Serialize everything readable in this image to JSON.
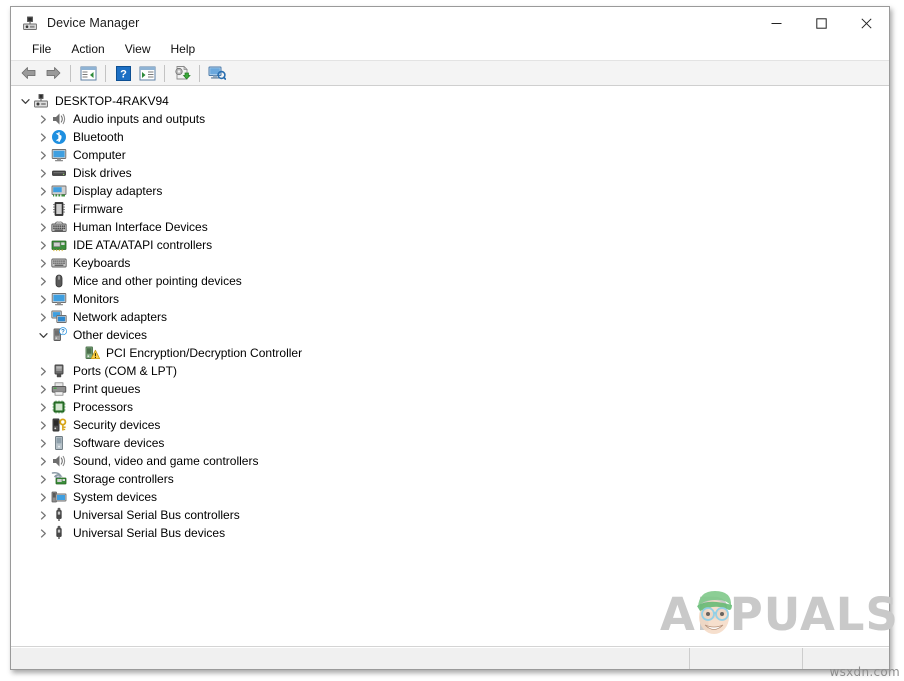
{
  "window": {
    "title": "Device Manager",
    "icon": "device-manager-icon",
    "caption": {
      "minimize": "—",
      "maximize": "☐",
      "close": "✕",
      "minimize_name": "minimize-button",
      "maximize_name": "maximize-button",
      "close_name": "close-button"
    }
  },
  "menubar": {
    "items": [
      {
        "label": "File",
        "name": "menu-file"
      },
      {
        "label": "Action",
        "name": "menu-action"
      },
      {
        "label": "View",
        "name": "menu-view"
      },
      {
        "label": "Help",
        "name": "menu-help"
      }
    ]
  },
  "toolbar": {
    "buttons": [
      {
        "name": "back-button",
        "icon": "back-arrow-icon",
        "tooltip": "Back"
      },
      {
        "name": "forward-button",
        "icon": "forward-arrow-icon",
        "tooltip": "Forward"
      },
      {
        "name": "separator-1",
        "icon": "separator"
      },
      {
        "name": "show-hide-console-tree-button",
        "icon": "console-tree-icon",
        "tooltip": "Show/Hide console tree"
      },
      {
        "name": "separator-2",
        "icon": "separator"
      },
      {
        "name": "help-button",
        "icon": "help-question-icon",
        "tooltip": "Help"
      },
      {
        "name": "properties-button",
        "icon": "properties-window-icon",
        "tooltip": "Properties"
      },
      {
        "name": "separator-3",
        "icon": "separator"
      },
      {
        "name": "update-driver-button",
        "icon": "update-driver-icon",
        "tooltip": "Update driver"
      },
      {
        "name": "separator-4",
        "icon": "separator"
      },
      {
        "name": "scan-hardware-changes-button",
        "icon": "scan-monitor-icon",
        "tooltip": "Scan for hardware changes"
      }
    ]
  },
  "tree": {
    "nodes": [
      {
        "label": "DESKTOP-4RAKV94",
        "level": 0,
        "expander": "expanded",
        "icon": "computer-root-icon",
        "name": "tree-node-desktop-4rakv94"
      },
      {
        "label": "Audio inputs and outputs",
        "level": 1,
        "expander": "collapsed",
        "icon": "speaker-icon",
        "name": "tree-node-audio-inputs-and-outputs"
      },
      {
        "label": "Bluetooth",
        "level": 1,
        "expander": "collapsed",
        "icon": "bluetooth-icon",
        "name": "tree-node-bluetooth"
      },
      {
        "label": "Computer",
        "level": 1,
        "expander": "collapsed",
        "icon": "monitor-icon",
        "name": "tree-node-computer"
      },
      {
        "label": "Disk drives",
        "level": 1,
        "expander": "collapsed",
        "icon": "disk-drive-icon",
        "name": "tree-node-disk-drives"
      },
      {
        "label": "Display adapters",
        "level": 1,
        "expander": "collapsed",
        "icon": "display-adapter-icon",
        "name": "tree-node-display-adapters"
      },
      {
        "label": "Firmware",
        "level": 1,
        "expander": "collapsed",
        "icon": "firmware-chip-icon",
        "name": "tree-node-firmware"
      },
      {
        "label": "Human Interface Devices",
        "level": 1,
        "expander": "collapsed",
        "icon": "hid-keyboard-icon",
        "name": "tree-node-human-interface-devices"
      },
      {
        "label": "IDE ATA/ATAPI controllers",
        "level": 1,
        "expander": "collapsed",
        "icon": "ide-controller-icon",
        "name": "tree-node-ide-ata-atapi-controllers"
      },
      {
        "label": "Keyboards",
        "level": 1,
        "expander": "collapsed",
        "icon": "keyboard-icon",
        "name": "tree-node-keyboards"
      },
      {
        "label": "Mice and other pointing devices",
        "level": 1,
        "expander": "collapsed",
        "icon": "mouse-icon",
        "name": "tree-node-mice-and-other-pointing-devices"
      },
      {
        "label": "Monitors",
        "level": 1,
        "expander": "collapsed",
        "icon": "monitor-icon",
        "name": "tree-node-monitors"
      },
      {
        "label": "Network adapters",
        "level": 1,
        "expander": "collapsed",
        "icon": "network-adapter-icon",
        "name": "tree-node-network-adapters"
      },
      {
        "label": "Other devices",
        "level": 1,
        "expander": "expanded",
        "icon": "unknown-device-icon",
        "name": "tree-node-other-devices"
      },
      {
        "label": "PCI Encryption/Decryption Controller",
        "level": 2,
        "expander": "none",
        "icon": "warning-device-icon",
        "name": "tree-node-pci-encryption-decryption-controller"
      },
      {
        "label": "Ports (COM & LPT)",
        "level": 1,
        "expander": "collapsed",
        "icon": "port-icon",
        "name": "tree-node-ports-com-and-lpt"
      },
      {
        "label": "Print queues",
        "level": 1,
        "expander": "collapsed",
        "icon": "printer-icon",
        "name": "tree-node-print-queues"
      },
      {
        "label": "Processors",
        "level": 1,
        "expander": "collapsed",
        "icon": "processor-chip-icon",
        "name": "tree-node-processors"
      },
      {
        "label": "Security devices",
        "level": 1,
        "expander": "collapsed",
        "icon": "security-key-icon",
        "name": "tree-node-security-devices"
      },
      {
        "label": "Software devices",
        "level": 1,
        "expander": "collapsed",
        "icon": "software-device-icon",
        "name": "tree-node-software-devices"
      },
      {
        "label": "Sound, video and game controllers",
        "level": 1,
        "expander": "collapsed",
        "icon": "speaker-icon",
        "name": "tree-node-sound-video-and-game-controllers"
      },
      {
        "label": "Storage controllers",
        "level": 1,
        "expander": "collapsed",
        "icon": "storage-controller-icon",
        "name": "tree-node-storage-controllers"
      },
      {
        "label": "System devices",
        "level": 1,
        "expander": "collapsed",
        "icon": "system-device-icon",
        "name": "tree-node-system-devices"
      },
      {
        "label": "Universal Serial Bus controllers",
        "level": 1,
        "expander": "collapsed",
        "icon": "usb-icon",
        "name": "tree-node-universal-serial-bus-controllers"
      },
      {
        "label": "Universal Serial Bus devices",
        "level": 1,
        "expander": "collapsed",
        "icon": "usb-icon",
        "name": "tree-node-universal-serial-bus-devices"
      }
    ]
  },
  "statusbar": {
    "main_text": "",
    "pane2_text": "",
    "pane3_text": ""
  },
  "watermark": {
    "text": "APPUALS",
    "mascot": "appuals-mascot-face"
  },
  "site_tag": "wsxdn.com",
  "colors": {
    "accent_blue": "#0a84d8",
    "warning_yellow": "#ffd24a",
    "window_border": "#9a9a9a",
    "toolbar_bg": "#f4f4f4",
    "statusbar_bg": "#f0f0f0",
    "watermark_gray": "#c9c9c9"
  }
}
